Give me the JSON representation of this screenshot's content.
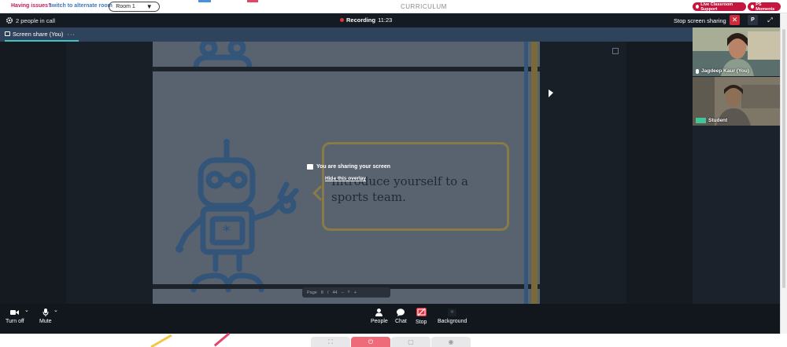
{
  "topbar": {
    "issues_text": "Having issues?",
    "switch_text": "switch to alternate room",
    "room_select": "Room 1",
    "title": "CURRICULUM",
    "support_label": "Live Classroom Support",
    "moments_label": "PS Moments"
  },
  "call": {
    "people_count": "2 people in call",
    "recording_label": "Recording",
    "recording_time": "11:23",
    "stop_sharing_label": "Stop screen sharing",
    "p_button": "P"
  },
  "tab": {
    "label": "Screen share (You)",
    "more": "···"
  },
  "slide": {
    "speech_text": "Introduce yourself to a sports team."
  },
  "overlay": {
    "message": "You are sharing your screen",
    "hide_link": "Hide this overlay"
  },
  "pager": {
    "label": "Page",
    "current": "8",
    "separator": "/",
    "total": "44",
    "zoom_out": "−",
    "zoom_in": "+"
  },
  "tiles": [
    {
      "name": "Jagdeep Kaur (You)"
    },
    {
      "name": "Student"
    }
  ],
  "controls": {
    "turn_off": "Turn off",
    "mute": "Mute",
    "people": "People",
    "chat": "Chat",
    "stop": "Stop",
    "background": "Background"
  },
  "colors": {
    "record_dot": "#e5343c",
    "tab_underline": "#3ec3c6",
    "stop_red": "#e0303e",
    "brand_pink": "#c4163f"
  }
}
